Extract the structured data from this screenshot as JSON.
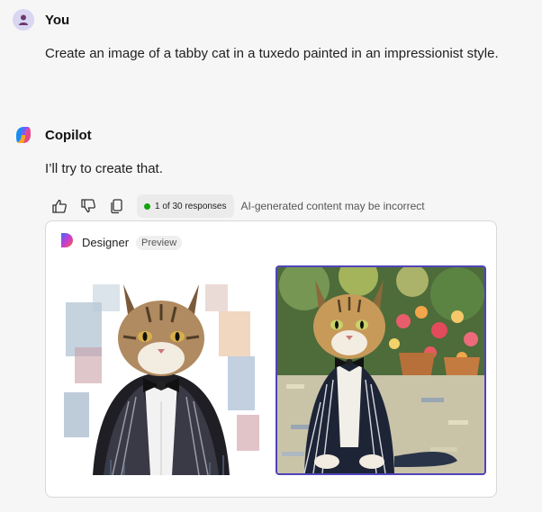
{
  "user": {
    "name": "You",
    "message": "Create an image of a tabby cat in a tuxedo painted in an impressionist style."
  },
  "copilot": {
    "name": "Copilot",
    "message": "I’ll try to create that."
  },
  "actions": {
    "thumbs_up_icon": "thumbs-up",
    "thumbs_down_icon": "thumbs-down",
    "copy_icon": "copy",
    "responses": "1 of 30 responses",
    "disclaimer": "AI-generated content may be incorrect"
  },
  "designer": {
    "name": "Designer",
    "badge": "Preview",
    "images": [
      {
        "style": "watercolor tabby cat in tuxedo",
        "selected": false
      },
      {
        "style": "impressionist tabby cat in pinstripe suit in garden",
        "selected": true
      }
    ]
  },
  "colors": {
    "accent": "#4f43b9",
    "status_green": "#13a10e",
    "background": "#f6f6f6"
  }
}
